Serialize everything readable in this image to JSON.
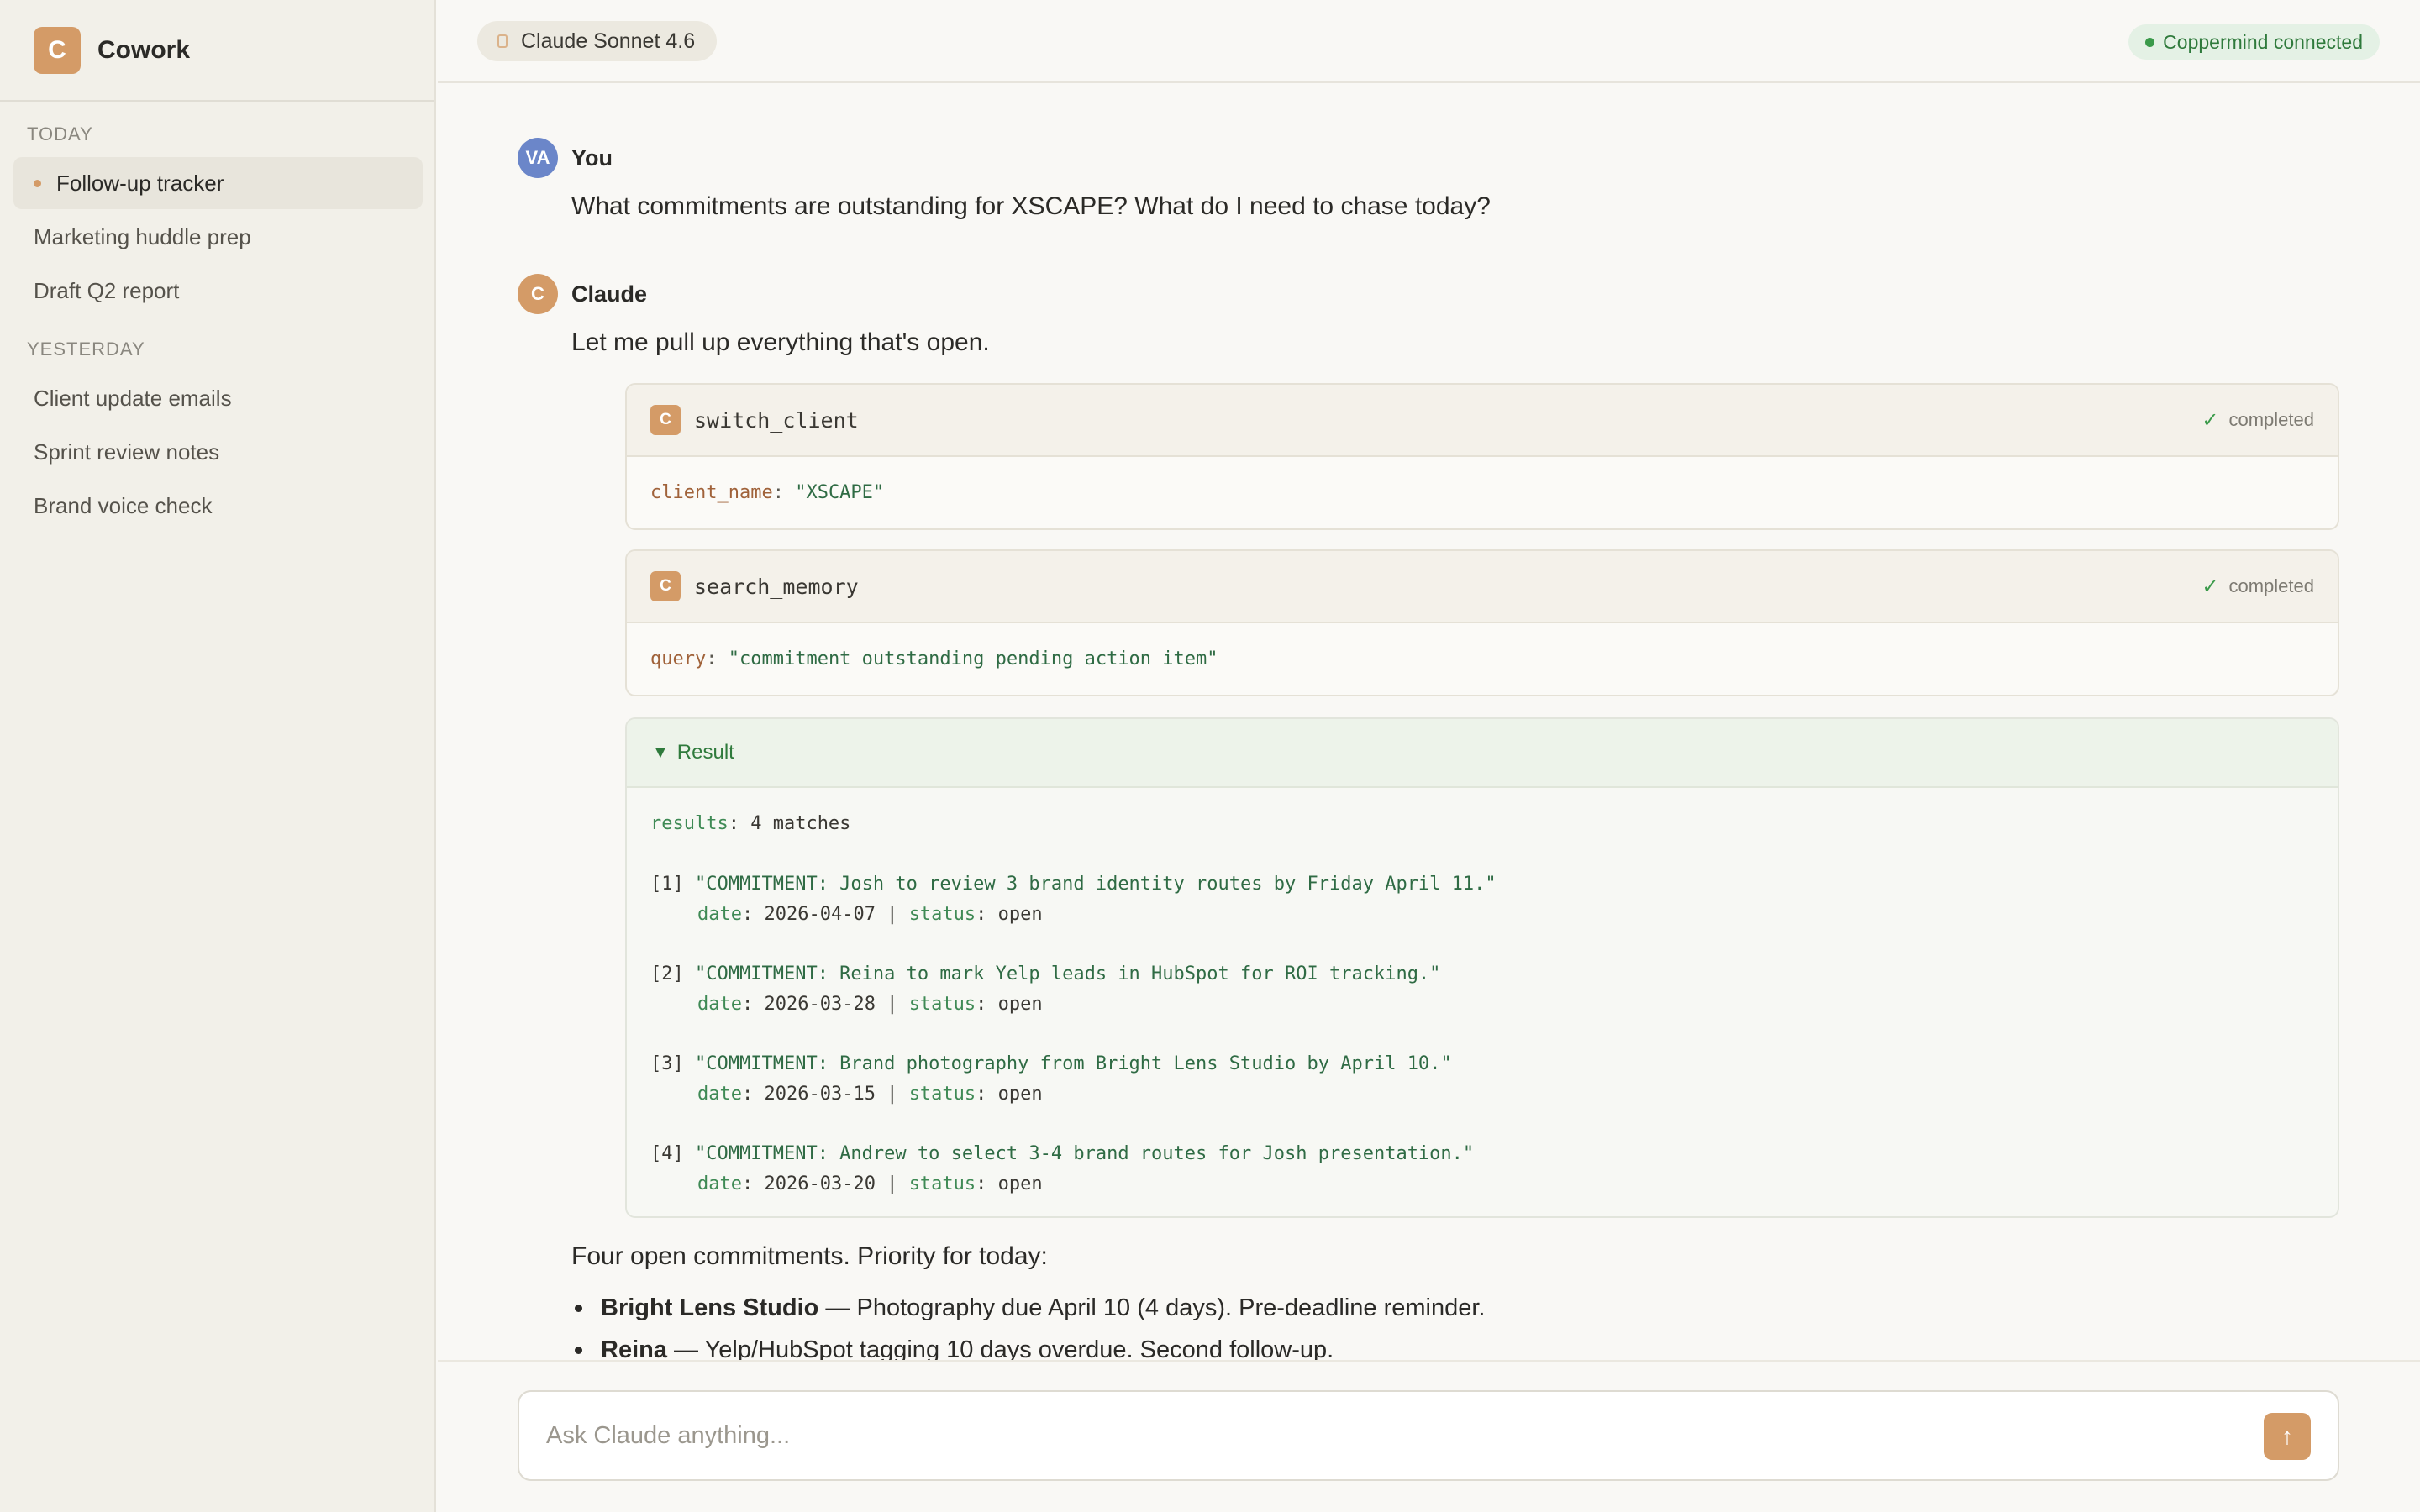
{
  "app": {
    "name": "Cowork",
    "logo_letter": "C"
  },
  "sidebar": {
    "sections": [
      {
        "label": "TODAY",
        "items": [
          {
            "label": "Follow-up tracker",
            "active": true
          },
          {
            "label": "Marketing huddle prep"
          },
          {
            "label": "Draft Q2 report"
          }
        ]
      },
      {
        "label": "YESTERDAY",
        "items": [
          {
            "label": "Client update emails"
          },
          {
            "label": "Sprint review notes"
          },
          {
            "label": "Brand voice check"
          }
        ]
      }
    ]
  },
  "header": {
    "model": "Claude Sonnet 4.6",
    "connection": "Coppermind connected"
  },
  "messages": {
    "user": {
      "avatar": "VA",
      "name": "You",
      "text": "What commitments are outstanding for XSCAPE? What do I need to chase today?"
    },
    "assistant": {
      "avatar": "C",
      "name": "Claude",
      "intro": "Let me pull up everything that's open."
    }
  },
  "tools": [
    {
      "icon_letter": "C",
      "name": "switch_client",
      "status": "completed",
      "param_key": "client_name",
      "param_value": "\"XSCAPE\""
    },
    {
      "icon_letter": "C",
      "name": "search_memory",
      "status": "completed",
      "param_key": "query",
      "param_value": "\"commitment outstanding pending action item\""
    }
  ],
  "result": {
    "label": "Result",
    "summary_key": "results",
    "summary_value": "4 matches",
    "items": [
      {
        "idx": "[1]",
        "text": "\"COMMITMENT: Josh to review 3 brand identity routes by Friday April 11.\"",
        "date": "2026-04-07",
        "status": "open"
      },
      {
        "idx": "[2]",
        "text": "\"COMMITMENT: Reina to mark Yelp leads in HubSpot for ROI tracking.\"",
        "date": "2026-03-28",
        "status": "open"
      },
      {
        "idx": "[3]",
        "text": "\"COMMITMENT: Brand photography from Bright Lens Studio by April 10.\"",
        "date": "2026-03-15",
        "status": "open"
      },
      {
        "idx": "[4]",
        "text": "\"COMMITMENT: Andrew to select 3-4 brand routes for Josh presentation.\"",
        "date": "2026-03-20",
        "status": "open"
      }
    ],
    "date_key": "date",
    "status_key": "status"
  },
  "summary": {
    "text": "Four open commitments. Priority for today:",
    "bullets": [
      {
        "bold": "Bright Lens Studio",
        "rest": " — Photography due April 10 (4 days). Pre-deadline reminder."
      },
      {
        "bold": "Reina",
        "rest": " — Yelp/HubSpot tagging 10 days overdue. Second follow-up."
      }
    ]
  },
  "composer": {
    "placeholder": "Ask Claude anything..."
  },
  "colors": {
    "accent": "#d49b67",
    "user_avatar": "#6b86c9",
    "success": "#3a9a4a"
  }
}
